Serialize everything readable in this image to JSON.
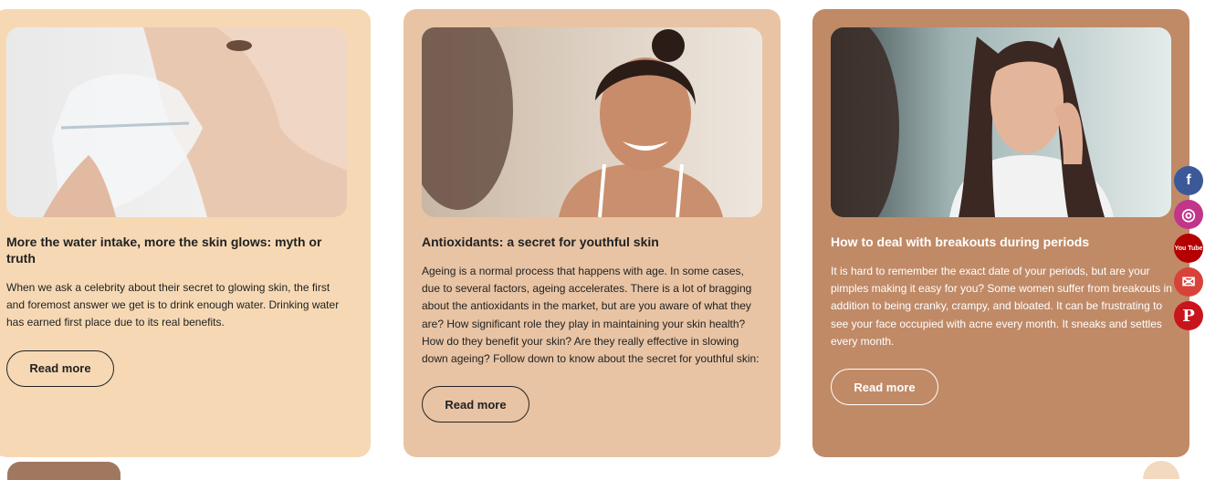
{
  "cards": [
    {
      "title": "More the water intake, more the skin glows: myth or truth",
      "excerpt": "When we ask a celebrity about their secret to glowing skin, the first and foremost answer we get is to drink enough water. Drinking water has earned first place due to its real benefits.",
      "button": "Read more",
      "bg": "#f6d9b4",
      "text_color": "#222222"
    },
    {
      "title": "Antioxidants: a secret for youthful skin",
      "excerpt": "Ageing is a normal process that happens with age. In some cases, due to several factors, ageing accelerates. There is a lot of bragging about the antioxidants in the market, but are you aware of what they are? How significant role they play in maintaining your skin health? How do they benefit your skin? Are they really effective in slowing down ageing? Follow down to know about the secret for youthful skin:",
      "button": "Read more",
      "bg": "#e8c4a4",
      "text_color": "#222222"
    },
    {
      "title": "How to deal with breakouts during periods",
      "excerpt": "It is hard to remember the exact date of your periods, but are your pimples making it easy for you? Some women suffer from breakouts in addition to being cranky, crampy, and bloated. It can be frustrating to see your face occupied with acne every month. It sneaks and settles every month.",
      "button": "Read more",
      "bg": "#c08a67",
      "text_color": "#ffffff"
    }
  ],
  "social": [
    {
      "icon": "facebook-icon",
      "glyph": "f",
      "color": "#3b5998"
    },
    {
      "icon": "instagram-icon",
      "glyph": "◎",
      "color": "#c1358a"
    },
    {
      "icon": "youtube-icon",
      "glyph": "You Tube",
      "color": "#b40000"
    },
    {
      "icon": "mail-icon",
      "glyph": "✉",
      "color": "#d9423b"
    },
    {
      "icon": "pinterest-icon",
      "glyph": "P",
      "color": "#c8141d"
    }
  ]
}
